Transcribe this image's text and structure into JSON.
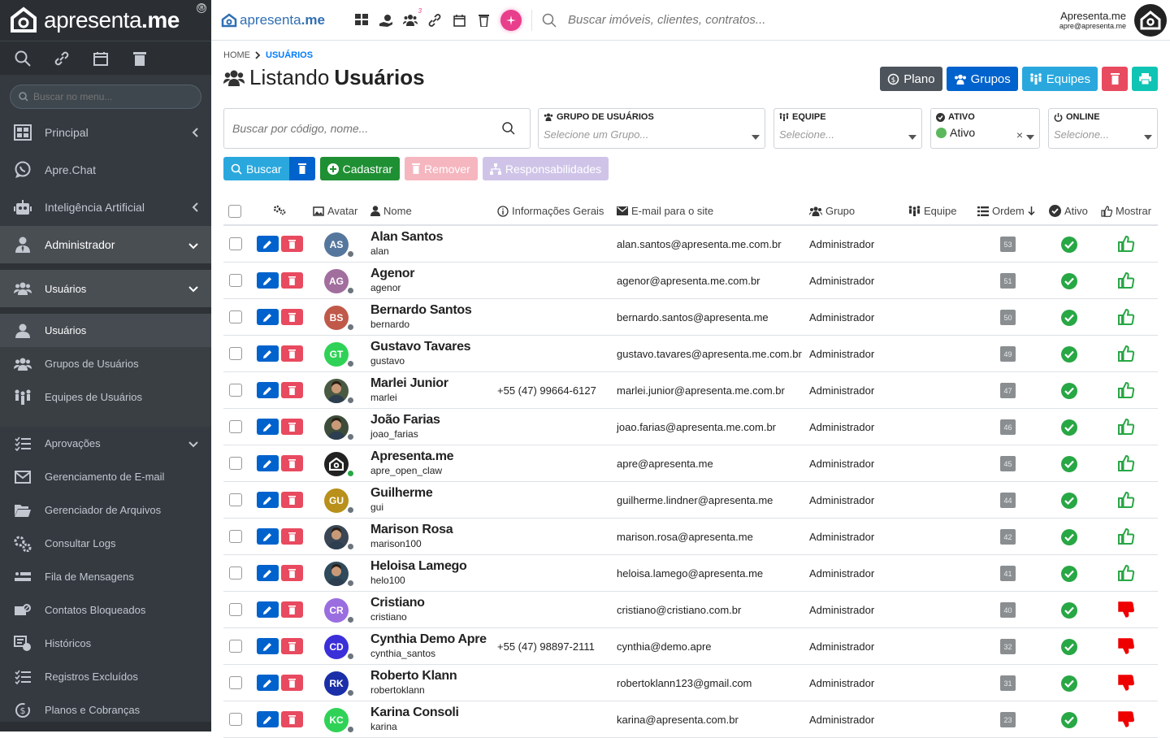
{
  "sidebar": {
    "logo_text_light": "apresenta",
    "logo_text_bold": ".me",
    "search_placeholder": "Buscar no menu...",
    "items": [
      {
        "label": "Principal"
      },
      {
        "label": "Apre.Chat"
      },
      {
        "label": "Inteligência Artificial"
      },
      {
        "label": "Administrador"
      },
      {
        "label": "Usuários"
      },
      {
        "label": "Usuários"
      },
      {
        "label": "Grupos de Usuários"
      },
      {
        "label": "Equipes de Usuários"
      },
      {
        "label": "Aprovações"
      },
      {
        "label": "Gerenciamento de E-mail"
      },
      {
        "label": "Gerenciador de Arquivos"
      },
      {
        "label": "Consultar Logs"
      },
      {
        "label": "Fila de Mensagens"
      },
      {
        "label": "Contatos Bloqueados"
      },
      {
        "label": "Históricos"
      },
      {
        "label": "Registros Excluídos"
      },
      {
        "label": "Planos e Cobranças"
      }
    ]
  },
  "topbar": {
    "logo_light": "apresenta",
    "logo_bold": "me",
    "badge": "3",
    "search_placeholder": "Buscar imóveis, clientes, contratos...",
    "user_name": "Apresenta.me",
    "user_email": "apre@apresenta.me"
  },
  "breadcrumb": {
    "home": "HOME",
    "current": "USUÁRIOS"
  },
  "page": {
    "title_light": "Listando",
    "title_bold": "Usuários"
  },
  "actions": {
    "plano": "Plano",
    "grupos": "Grupos",
    "equipes": "Equipes"
  },
  "filters": {
    "search_placeholder": "Buscar por código, nome...",
    "grupo_label": "GRUPO DE USUÁRIOS",
    "grupo_placeholder": "Selecione um Grupo...",
    "equipe_label": "EQUIPE",
    "equipe_placeholder": "Selecione...",
    "ativo_label": "ATIVO",
    "ativo_value": "Ativo",
    "online_label": "ONLINE",
    "online_placeholder": "Selecione..."
  },
  "buttons": {
    "buscar": "Buscar",
    "cadastrar": "Cadastrar",
    "remover": "Remover",
    "responsabilidades": "Responsabilidades"
  },
  "columns": {
    "avatar": "Avatar",
    "nome": "Nome",
    "info": "Informações Gerais",
    "email": "E-mail para o site",
    "grupo": "Grupo",
    "equipe": "Equipe",
    "ordem": "Ordem",
    "ativo": "Ativo",
    "mostrar": "Mostrar"
  },
  "colors": {
    "ok": "#28a745",
    "thumb_up": "#28a745",
    "thumb_down": "#e00"
  },
  "rows": [
    {
      "name": "Alan Santos",
      "login": "alan",
      "initials": "AS",
      "avatar_color": "#56779d",
      "online": false,
      "info": "",
      "email": "alan.santos@apresenta.me.com.br",
      "group": "Administrador",
      "order": "53",
      "show": true
    },
    {
      "name": "Agenor",
      "login": "agenor",
      "initials": "AG",
      "avatar_color": "#a26e9e",
      "online": false,
      "info": "",
      "email": "agenor@apresenta.me.com.br",
      "group": "Administrador",
      "order": "51",
      "show": true
    },
    {
      "name": "Bernardo Santos",
      "login": "bernardo",
      "initials": "BS",
      "avatar_color": "#c0594a",
      "online": false,
      "info": "",
      "email": "bernardo.santos@apresenta.me",
      "group": "Administrador",
      "order": "50",
      "show": true
    },
    {
      "name": "Gustavo Tavares",
      "login": "gustavo",
      "initials": "GT",
      "avatar_color": "#2fd256",
      "online": false,
      "info": "",
      "email": "gustavo.tavares@apresenta.me.com.br",
      "group": "Administrador",
      "order": "49",
      "show": true
    },
    {
      "name": "Marlei Junior",
      "login": "marlei",
      "initials": "",
      "avatar_color": "#4a5a42",
      "online": false,
      "info": "+55 (47) 99664-6127",
      "email": "marlei.junior@apresenta.me.com.br",
      "group": "Administrador",
      "order": "47",
      "show": true
    },
    {
      "name": "João Farias",
      "login": "joao_farias",
      "initials": "",
      "avatar_color": "#3d4d3a",
      "online": false,
      "info": "",
      "email": "joao.farias@apresenta.me.com.br",
      "group": "Administrador",
      "order": "46",
      "show": true
    },
    {
      "name": "Apresenta.me",
      "login": "apre_open_claw",
      "initials": "",
      "avatar_color": "#222222",
      "online": true,
      "info": "",
      "email": "apre@apresenta.me",
      "group": "Administrador",
      "order": "45",
      "show": true
    },
    {
      "name": "Guilherme",
      "login": "gui",
      "initials": "GU",
      "avatar_color": "#b8901a",
      "online": false,
      "info": "",
      "email": "guilherme.lindner@apresenta.me",
      "group": "Administrador",
      "order": "44",
      "show": true
    },
    {
      "name": "Marison Rosa",
      "login": "marison100",
      "initials": "",
      "avatar_color": "#3a4655",
      "online": false,
      "info": "",
      "email": "marison.rosa@apresenta.me",
      "group": "Administrador",
      "order": "42",
      "show": true
    },
    {
      "name": "Heloisa Lamego",
      "login": "helo100",
      "initials": "",
      "avatar_color": "#2f4a5a",
      "online": false,
      "info": "",
      "email": "heloisa.lamego@apresenta.me",
      "group": "Administrador",
      "order": "41",
      "show": true
    },
    {
      "name": "Cristiano",
      "login": "cristiano",
      "initials": "CR",
      "avatar_color": "#9a6ee0",
      "online": false,
      "info": "",
      "email": "cristiano@cristiano.com.br",
      "group": "Administrador",
      "order": "40",
      "show": false
    },
    {
      "name": "Cynthia Demo Apre",
      "login": "cynthia_santos",
      "initials": "CD",
      "avatar_color": "#3a2fd8",
      "online": false,
      "info": "+55 (47) 98897-2111",
      "email": "cynthia@demo.apre",
      "group": "Administrador",
      "order": "32",
      "show": false
    },
    {
      "name": "Roberto Klann",
      "login": "robertoklann",
      "initials": "RK",
      "avatar_color": "#1a2fa8",
      "online": false,
      "info": "",
      "email": "robertoklann123@gmail.com",
      "group": "Administrador",
      "order": "31",
      "show": false
    },
    {
      "name": "Karina Consoli",
      "login": "karina",
      "initials": "KC",
      "avatar_color": "#2fd256",
      "online": false,
      "info": "",
      "email": "karina@apresenta.com.br",
      "group": "Administrador",
      "order": "23",
      "show": false
    }
  ]
}
